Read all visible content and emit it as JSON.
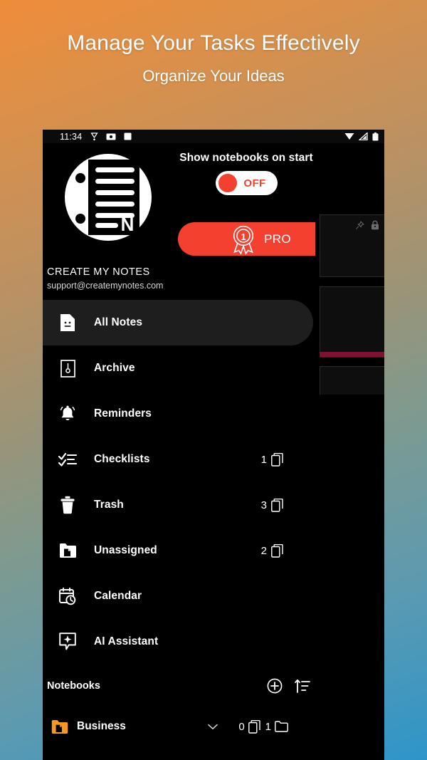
{
  "promo": {
    "title": "Manage Your Tasks Effectively",
    "subtitle": "Organize Your Ideas"
  },
  "statusbar": {
    "time": "11:34",
    "left_icons": [
      "location-icon",
      "camera-icon",
      "square-icon"
    ],
    "right_icons": [
      "download-icon",
      "signal-icon",
      "battery-icon"
    ]
  },
  "drawer": {
    "logo_letter": "N",
    "show_notebooks_label": "Show notebooks on start",
    "toggle_state": "OFF",
    "pro_label": "PRO",
    "pro_badge_number": "1",
    "account_name": "CREATE MY NOTES",
    "account_email": "support@createmynotes.com",
    "nav": [
      {
        "label": "All Notes",
        "icon": "note-icon",
        "count": "",
        "selected": true
      },
      {
        "label": "Archive",
        "icon": "archive-icon",
        "count": "",
        "selected": false
      },
      {
        "label": "Reminders",
        "icon": "bell-icon",
        "count": "",
        "selected": false
      },
      {
        "label": "Checklists",
        "icon": "checklist-icon",
        "count": "1",
        "selected": false
      },
      {
        "label": "Trash",
        "icon": "trash-icon",
        "count": "3",
        "selected": false
      },
      {
        "label": "Unassigned",
        "icon": "folder-doc-icon",
        "count": "2",
        "selected": false
      },
      {
        "label": "Calendar",
        "icon": "calendar-icon",
        "count": "",
        "selected": false
      },
      {
        "label": "AI Assistant",
        "icon": "sparkle-icon",
        "count": "",
        "selected": false
      }
    ],
    "notebooks_title": "Notebooks",
    "notebooks_tools": [
      "add-circle-icon",
      "sort-icon",
      "expand-icon"
    ],
    "notebooks": [
      {
        "name": "Business",
        "notes_count": "0",
        "folders_count": "1",
        "color": "#f59a1f"
      }
    ]
  },
  "colors": {
    "accent_red": "#f4402f",
    "drawer_bg": "#000000",
    "selected_row": "#1e1e1e",
    "card_accent": "#7d1231",
    "notebook_orange": "#f59a1f"
  }
}
